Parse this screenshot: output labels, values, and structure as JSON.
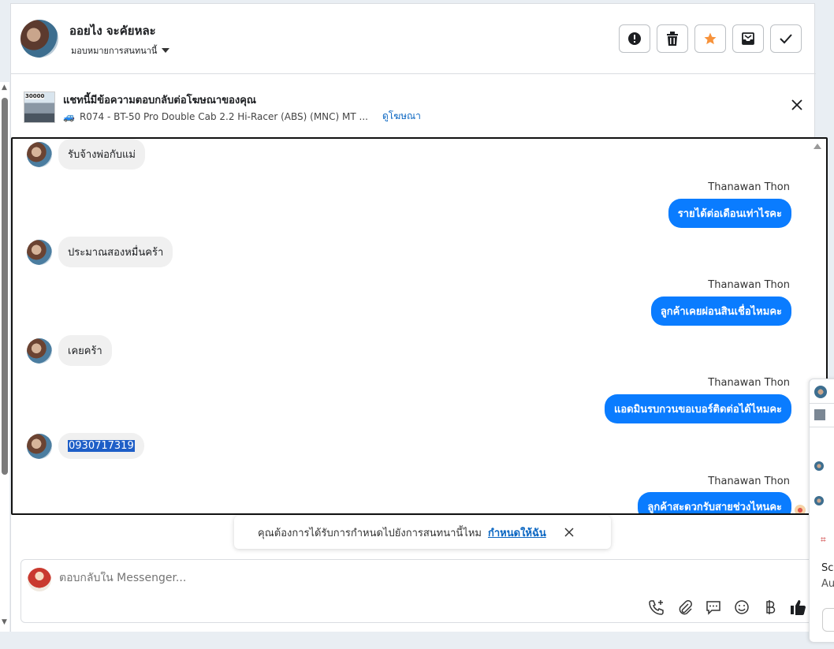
{
  "header": {
    "contact_name": "ออยไง จะคัยหละ",
    "assign_label": "มอบหมายการสนทนานี้",
    "actions": [
      "alert-icon",
      "trash-icon",
      "star-icon",
      "archive-icon",
      "check-icon"
    ],
    "star_color": "#f7923a"
  },
  "ad": {
    "title": "แชทนี้มีข้อความตอบกลับต่อโฆษณาของคุณ",
    "thumb_text": "30000",
    "product": "R074 - BT-50 Pro Double Cab 2.2 Hi-Racer (ABS) (MNC) MT ...",
    "link": "ดูโฆษณา"
  },
  "messages": [
    {
      "dir": "in",
      "text": "รับจ้างพ่อกับแม่"
    },
    {
      "dir": "out",
      "sender": "Thanawan Thon",
      "text": "รายได้ต่อเดือนเท่าไรคะ"
    },
    {
      "dir": "in",
      "text": "ประมาณสองหมื่นคร้า"
    },
    {
      "dir": "out",
      "sender": "Thanawan Thon",
      "text": "ลูกค้าเคยผ่อนสินเชื่อไหมคะ"
    },
    {
      "dir": "in",
      "text": "เคยคร้า"
    },
    {
      "dir": "out",
      "sender": "Thanawan Thon",
      "text": "แอดมินรบกวนขอเบอร์ติดต่อได้ไหมคะ"
    },
    {
      "dir": "in",
      "text": "0930717319"
    },
    {
      "dir": "out",
      "sender": "Thanawan Thon",
      "text": "ลูกค้าสะดวกรับสายช่วงไหนคะ"
    }
  ],
  "toast": {
    "text": "คุณต้องการได้รับการกำหนดไปยังการสนทนานี้ไหม",
    "link": "กำหนดให้ฉัน"
  },
  "composer": {
    "placeholder": "ตอบกลับใน Messenger...",
    "tools": [
      "add-call-icon",
      "attach-icon",
      "saved-reply-icon",
      "emoji-icon",
      "baht-icon",
      "like-icon"
    ]
  },
  "peek": {
    "text1": "Sc",
    "text2": "Au"
  },
  "colors": {
    "accent": "#0a7cff",
    "link": "#0a66c2"
  }
}
